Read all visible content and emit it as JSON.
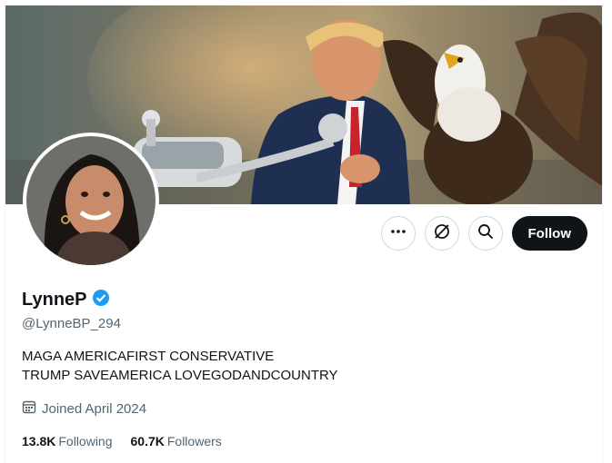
{
  "profile": {
    "display_name": "LynneP",
    "verified": true,
    "handle": "@LynneBP_294",
    "bio": "MAGA  AMERICAFIRST  CONSERVATIVE\nTRUMP  SAVEAMERICA LOVEGODANDCOUNTRY",
    "joined": "Joined April 2024",
    "following_count": "13.8K",
    "following_label": "Following",
    "followers_count": "60.7K",
    "followers_label": "Followers"
  },
  "actions": {
    "more_icon": "more-horizontal-icon",
    "subscribe_icon": "bell-slash-icon",
    "search_icon": "search-icon",
    "follow_label": "Follow"
  },
  "colors": {
    "verified_badge": "#1d9bf0",
    "follow_button": "#0f1419",
    "secondary_text": "#536471"
  }
}
